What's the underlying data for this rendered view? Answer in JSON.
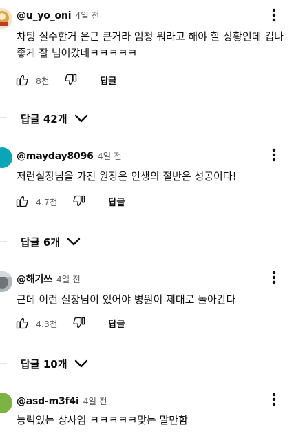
{
  "comments": [
    {
      "author": "@u_yo_oni",
      "time": "4일 전",
      "text": "차팅 실수한거 은근 큰거라 엄청 뭐라고 해야 할 상황인데 겁나 좋게 잘 넘어갔네ㅋㅋㅋㅋㅋ",
      "likes": "8천",
      "reply_label": "답글",
      "replies_label": "답글 42개",
      "avatar_color": "#d9a441"
    },
    {
      "author": "@mayday8096",
      "time": "4일 전",
      "text": "저런실장님을 가진 원장은 인생의 절반은 성공이다!",
      "likes": "4.7천",
      "reply_label": "답글",
      "replies_label": "답글 6개",
      "avatar_color": "#0aa6b8"
    },
    {
      "author": "@해기쓰",
      "time": "4일 전",
      "text": "근데 이런 실장님이 있어야 병원이 제대로 돌아간다",
      "likes": "4.3천",
      "reply_label": "답글",
      "replies_label": "답글 10개",
      "avatar_color": "#8b8f94"
    },
    {
      "author": "@asd-m3f4i",
      "time": "4일 전",
      "text": "능력있는 상사임 ㅋㅋㅋㅋㅋ맞는 말만함",
      "avatar_color": "#7cb342"
    }
  ]
}
